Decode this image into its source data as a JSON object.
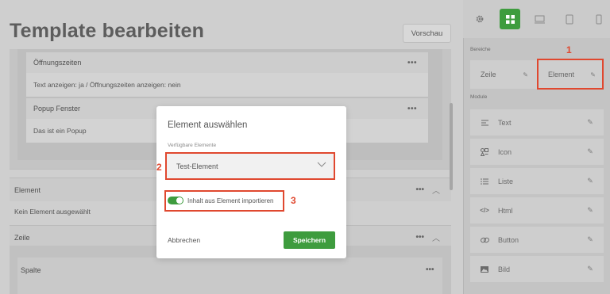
{
  "page": {
    "title": "Template bearbeiten",
    "preview_label": "Vorschau"
  },
  "editor": {
    "cards": [
      {
        "title": "Öffnungszeiten",
        "body": "Text anzeigen: ja / Öffnungszeiten anzeigen: nein"
      },
      {
        "title": "Popup Fenster",
        "body": "Das ist ein Popup"
      }
    ],
    "element_bar_label": "Element",
    "element_empty_text": "Kein Element ausgewählt",
    "zeile_bar_label": "Zeile",
    "spalte_label": "Spalte",
    "menu_dots": "•••"
  },
  "panel": {
    "bereiche_label": "Bereiche",
    "bereiche": [
      "Zeile",
      "Element"
    ],
    "module_label": "Module",
    "modules": [
      {
        "label": "Text",
        "icon": "text-align-icon"
      },
      {
        "label": "Icon",
        "icon": "shapes-icon"
      },
      {
        "label": "Liste",
        "icon": "list-icon"
      },
      {
        "label": "Html",
        "icon": "code-icon"
      },
      {
        "label": "Button",
        "icon": "link-icon"
      },
      {
        "label": "Bild",
        "icon": "image-icon"
      }
    ],
    "tabs": [
      "gear-icon",
      "grid-icon",
      "desktop-icon",
      "tablet-icon",
      "mobile-icon"
    ]
  },
  "modal": {
    "title": "Element auswählen",
    "field_label": "Verfügbare Elemente",
    "selected_value": "Test-Element",
    "toggle_label": "Inhalt aus Element importieren",
    "toggle_on": true,
    "cancel_label": "Abbrechen",
    "save_label": "Speichern"
  },
  "annotations": [
    "1",
    "2",
    "3"
  ],
  "colors": {
    "accent_green": "#3e9c3e",
    "annotation_red": "#e0482f"
  }
}
